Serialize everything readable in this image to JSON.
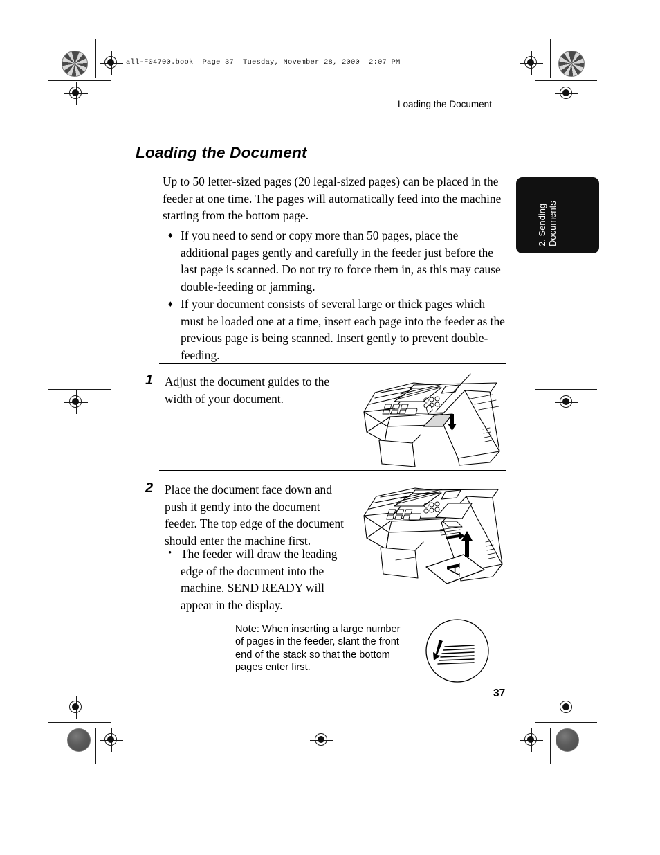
{
  "page": {
    "file_header": "all-F04700.book  Page 37  Tuesday, November 28, 2000  2:07 PM",
    "running_header": "Loading the Document",
    "page_number": "37",
    "side_tab_line1": "2. Sending",
    "side_tab_line2": "Documents",
    "side_tab_color": "#111111"
  },
  "section": {
    "title": "Loading the Document",
    "intro": "Up to 50 letter-sized pages (20 legal-sized pages) can be placed in the feeder at one time. The pages will automatically feed into the machine starting from the bottom page.",
    "bullets": [
      {
        "marker": "♦",
        "text": "If you need to send or copy more than 50 pages, place the additional pages gently and carefully in the feeder just before the last page is scanned. Do not try to force them in, as this may cause double-feeding or jamming."
      },
      {
        "marker": "♦",
        "text": "If your document consists of several large or thick pages which must be loaded one at a time, insert each page into the feeder as the previous page is being scanned. Insert gently to prevent double-feeding."
      }
    ]
  },
  "steps": [
    {
      "number": "1",
      "text": "Adjust the document guides to the width of your document.",
      "illustration": "fax-machine-adjust-guides"
    },
    {
      "number": "2",
      "text": "Place the document face down and push it gently into the document feeder. The top edge of the document should enter the machine first.",
      "illustration": "fax-machine-insert-document",
      "sub_bullets": [
        {
          "marker": "•",
          "text": "The feeder will draw the leading edge of the document into the machine. SEND READY will appear in the display."
        }
      ]
    }
  ],
  "note": {
    "text": "Note: When inserting a large number of pages in the feeder, slant the front end of the stack so that the bottom pages enter first.",
    "illustration": "slanted-paper-stack-circle"
  }
}
